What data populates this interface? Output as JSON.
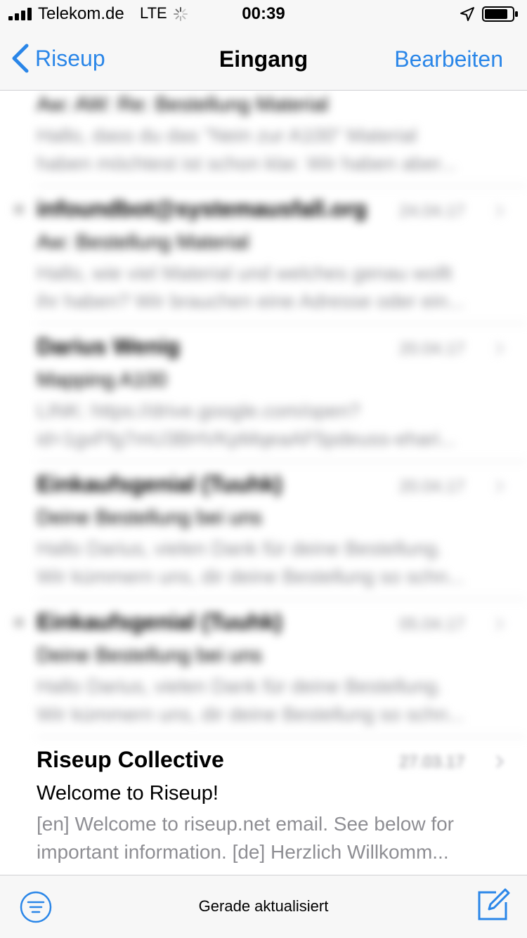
{
  "status_bar": {
    "carrier": "Telekom.de",
    "network": "LTE",
    "time": "00:39",
    "icons": [
      "signal-icon",
      "loading-spinner-icon",
      "location-arrow-icon",
      "battery-icon"
    ]
  },
  "nav": {
    "back_label": "Riseup",
    "title": "Eingang",
    "edit_label": "Bearbeiten"
  },
  "mails": [
    {
      "sender": "",
      "date": "",
      "subject": "Aw: AW: Re: Bestellung Material",
      "preview1": "Hallo, dass du das \"Nein zur A100\" Material",
      "preview2": "haben möchtest ist schon klar. Wir haben aber...",
      "unread": false
    },
    {
      "sender": "infoundbot@systemausfall.org",
      "date": "24.04.17",
      "subject": "Aw: Bestellung Material",
      "preview1": "Hallo, wie viel Material und welches genau wollt",
      "preview2": "ihr haben? Wir brauchen eine Adresse oder ein...",
      "unread": true
    },
    {
      "sender": "Darius Wenig",
      "date": "20.04.17",
      "subject": "Mapping A100",
      "preview1": "LINK: https://drive.google.com/open?",
      "preview2": "id=1gxFfg7mU3BHVKpMqeaAF5pdeuss-ehari...",
      "unread": false
    },
    {
      "sender": "Einkaufsgenial (Tuuhk)",
      "date": "20.04.17",
      "subject": "Deine Bestellung bei uns",
      "preview1": "Hallo Darius, vielen Dank für deine Bestellung.",
      "preview2": "Wir kümmern uns, dir deine Bestellung so schn...",
      "unread": false
    },
    {
      "sender": "Einkaufsgenial (Tuuhk)",
      "date": "05.04.17",
      "subject": "Deine Bestellung bei uns",
      "preview1": "Hallo Darius, vielen Dank für deine Bestellung.",
      "preview2": "Wir kümmern uns, dir deine Bestellung so schn...",
      "unread": true
    },
    {
      "sender": "Riseup Collective",
      "date": "27.03.17",
      "subject": "Welcome to Riseup!",
      "preview1": "[en] Welcome to riseup.net email. See below for",
      "preview2": "important information. [de] Herzlich Willkomm...",
      "unread": false
    }
  ],
  "toolbar": {
    "status": "Gerade aktualisiert",
    "filter_icon": "filter-icon",
    "compose_icon": "compose-icon"
  },
  "colors": {
    "accent": "#2a86e8",
    "secondary_text": "#8e8e93",
    "bar_background": "#f7f7f7",
    "separator": "#d0d0d4"
  }
}
